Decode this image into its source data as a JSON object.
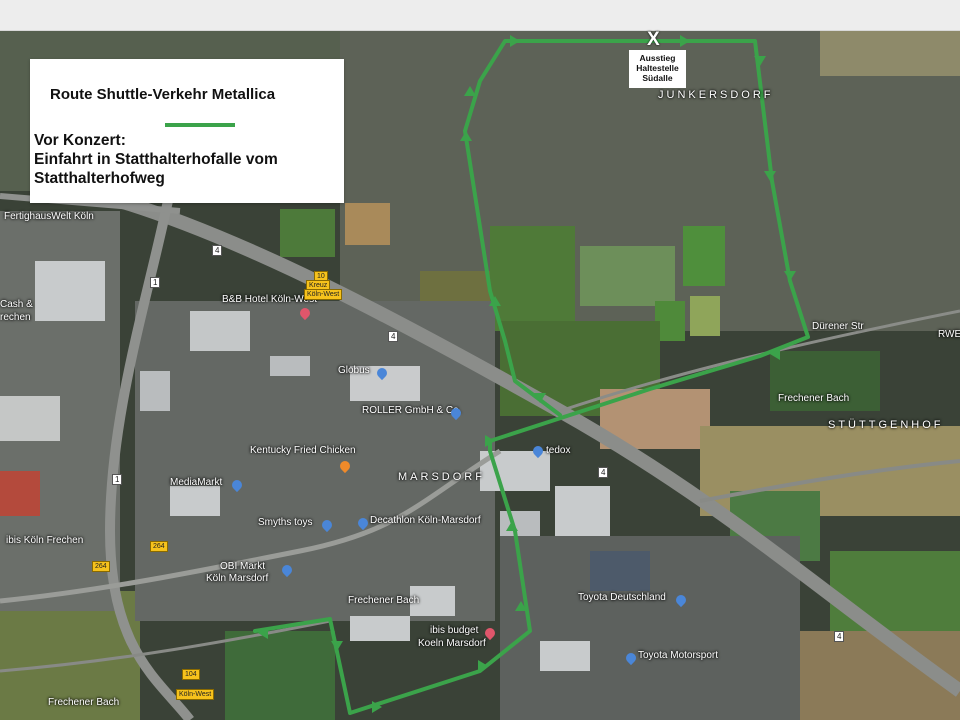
{
  "legend": {
    "title": "Route Shuttle-Verkehr Metallica",
    "line_color": "#3ba34a",
    "desc_line1": "Vor Konzert:",
    "desc_line2": "Einfahrt in Statthalterhofalle vom",
    "desc_line3": "Statthalterhofweg"
  },
  "destination": {
    "marker": "X",
    "line1": "Ausstieg",
    "line2": "Haltestelle",
    "line3": "Südalle"
  },
  "districts": {
    "junkersdorf": "JUNKERSDORF",
    "marsdorf": "MARSDORF",
    "stuttgenhof": "STÜTTGENHOF"
  },
  "places": {
    "fertighaus": "FertighausWelt Köln",
    "cash": "Cash &",
    "cash2": "rechen",
    "bb_hotel": "B&B Hotel Köln-West",
    "globus": "Globus",
    "roller": "ROLLER GmbH & Co.",
    "kfc": "Kentucky Fried Chicken",
    "mediamarkt": "MediaMarkt",
    "smyths": "Smyths toys",
    "decathlon": "Decathlon Köln-Marsdorf",
    "obi1": "OBI Markt",
    "obi2": "Köln Marsdorf",
    "ibis_frechen": "ibis Köln Frechen",
    "ibis_budget1": "ibis budget",
    "ibis_budget2": "Koeln Marsdorf",
    "toyota_de": "Toyota Deutschland",
    "toyota_ms": "Toyota Motorsport",
    "tedox": "tedox",
    "rwe": "RWE",
    "frechener_bach1": "Frechener Bach",
    "frechener_bach2": "Frechener Bach",
    "frechener_bach3": "Frechener Bach",
    "frechener_bach4": "Frechener Bach",
    "durener_str": "Dürener Str",
    "kreuz": "Kreuz",
    "koeln_west": "Köln-West",
    "koeln_west2": "Köln-West",
    "road_284a": "264",
    "road_284b": "264",
    "road_284c": "264",
    "a4_1": "4",
    "a4_2": "4",
    "a4_3": "4",
    "a4_4": "4",
    "a1_1": "1",
    "a1_2": "1",
    "exit_10": "10",
    "exit_104": "104",
    "road_264d": "264"
  },
  "colors": {
    "route": "#3ba34a",
    "map_dark": "#2f3a2e"
  }
}
